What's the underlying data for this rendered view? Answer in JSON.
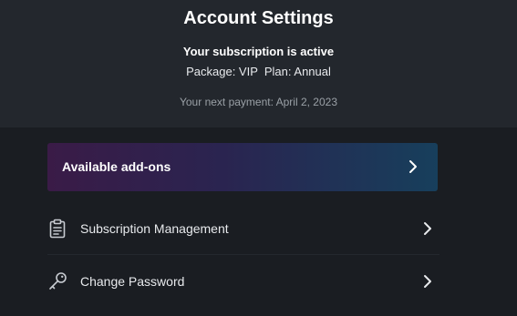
{
  "header": {
    "title": "Account Settings",
    "subscription_status": "Your subscription is active",
    "subscription_plan": "Package: VIP  Plan: Annual",
    "next_payment": "Your next payment: April 2, 2023"
  },
  "addons": {
    "label": "Available add-ons",
    "icon": "chevron-right-icon"
  },
  "menu": {
    "items": [
      {
        "label": "Subscription Management",
        "icon": "clipboard-icon"
      },
      {
        "label": "Change Password",
        "icon": "key-icon"
      }
    ]
  },
  "colors": {
    "background": "#1a1d22",
    "header_background": "#23272d",
    "addons_gradient_start": "#3a1b47",
    "addons_gradient_end": "#173f5c",
    "muted_text": "#9aa0a6"
  }
}
